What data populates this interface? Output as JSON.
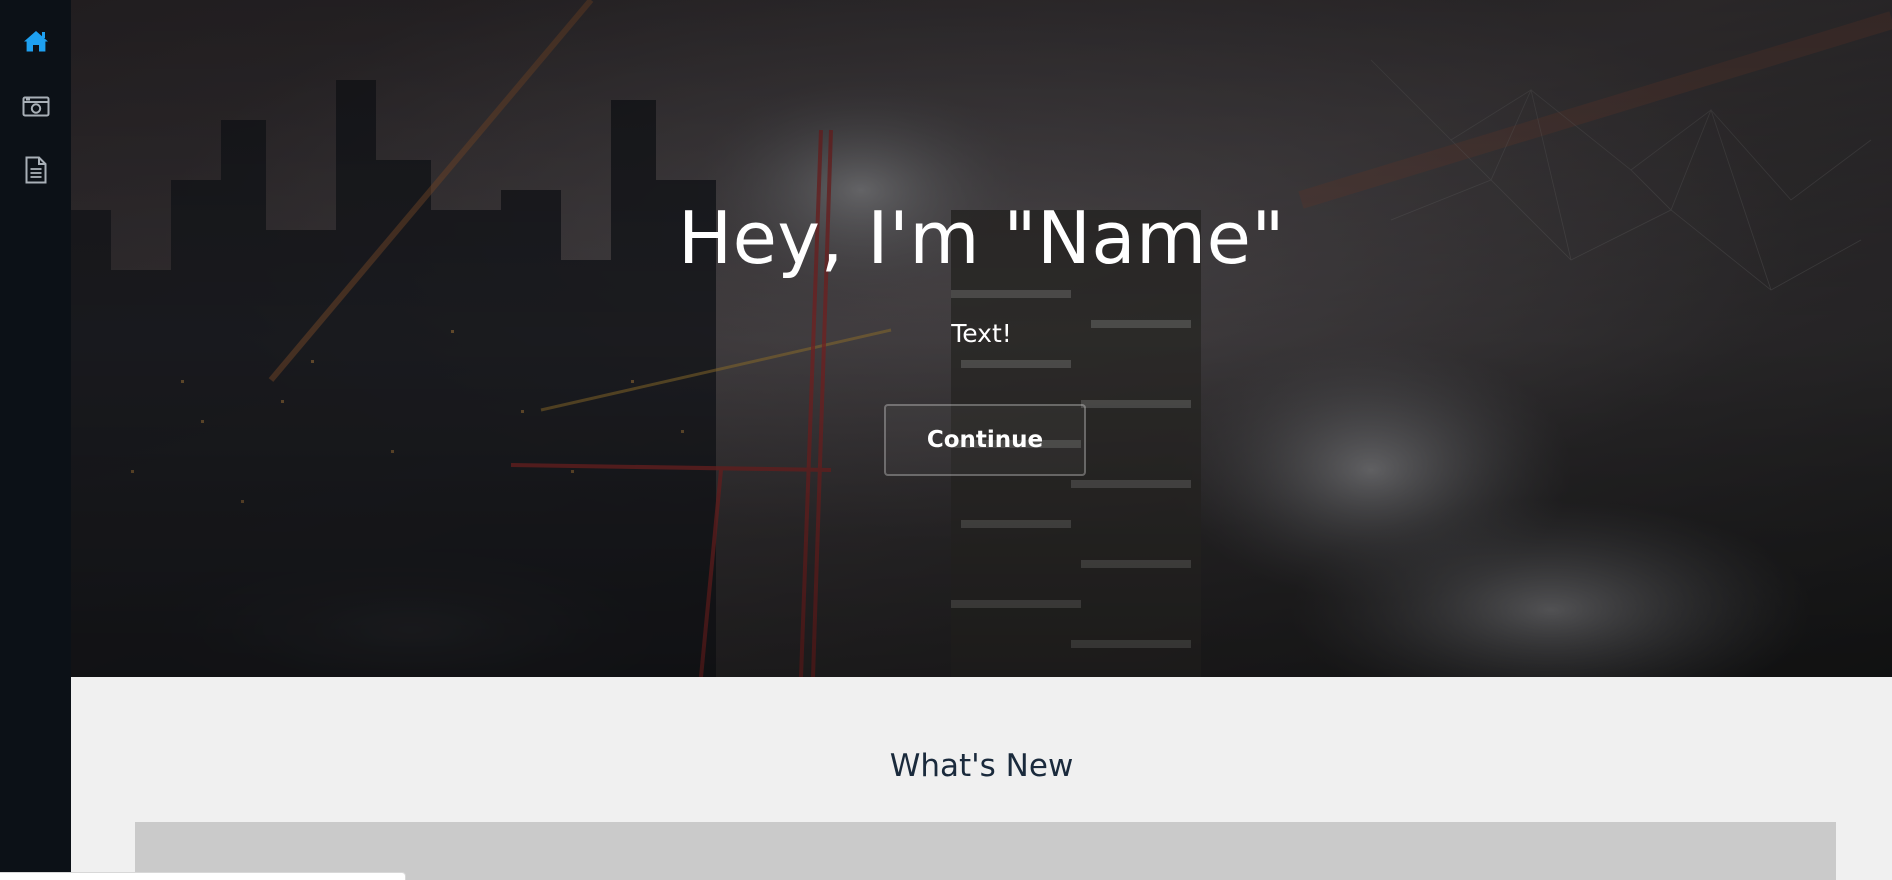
{
  "sidebar": {
    "items": [
      {
        "icon": "home-icon",
        "active": true
      },
      {
        "icon": "gallery-icon",
        "active": false
      },
      {
        "icon": "document-icon",
        "active": false
      }
    ],
    "active_color": "#1ea0f0",
    "icon_color": "#a9b0b7"
  },
  "hero": {
    "title": "Hey, I'm \"Name\"",
    "subtitle": "Text!",
    "button_label": "Continue"
  },
  "section": {
    "title": "What's New"
  }
}
